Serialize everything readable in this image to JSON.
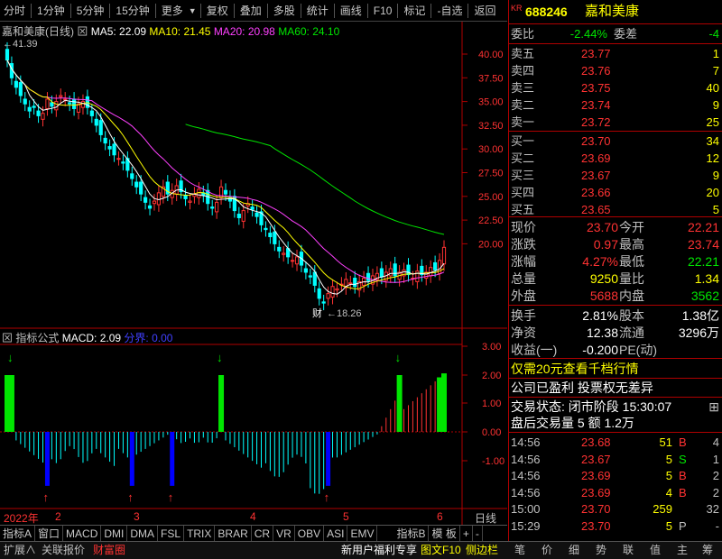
{
  "toolbar": {
    "items": [
      "分时",
      "1分钟",
      "5分钟",
      "15分钟",
      "更多",
      "复权",
      "叠加",
      "多股",
      "统计",
      "画线",
      "F10",
      "标记",
      "-自选",
      "返回"
    ]
  },
  "chart_header": {
    "name": "嘉和美康(日线)",
    "ma5": "MA5: 22.09",
    "ma10": "MA10: 21.45",
    "ma20": "MA20: 20.98",
    "ma60": "MA60: 24.10",
    "high_label": "41.39",
    "low_label": "18.26",
    "cai": "财"
  },
  "price_axis": [
    "40.00",
    "37.50",
    "35.00",
    "32.50",
    "30.00",
    "27.50",
    "25.00",
    "22.50",
    "20.00"
  ],
  "indicator": {
    "title": "指标公式",
    "macd": "MACD: 2.09",
    "boundary": "分界: 0.00",
    "axis": [
      "3.00",
      "2.00",
      "1.00",
      "0.00",
      "-1.00"
    ]
  },
  "date_axis": {
    "year": "2022年",
    "months": [
      "2",
      "3",
      "4",
      "5",
      "6"
    ],
    "period": "日线"
  },
  "bottom_tabs": [
    "指标A",
    "窗口",
    "MACD",
    "DMI",
    "DMA",
    "FSL",
    "TRIX",
    "BRAR",
    "CR",
    "VR",
    "OBV",
    "ASI",
    "EMV",
    "指标B",
    "模 板",
    "+",
    "-"
  ],
  "status_bar": {
    "left": [
      "扩展∧",
      "关联报价",
      "财富圈"
    ],
    "mid": [
      "新用户福利专享",
      "图文F10",
      "侧边栏"
    ],
    "right": [
      "笔",
      "价",
      "细",
      "势",
      "联",
      "值",
      "主",
      "筹"
    ]
  },
  "quote": {
    "kr": "KR",
    "code": "688246",
    "name": "嘉和美康",
    "weibi_label": "委比",
    "weibi": "-2.44%",
    "weicha_label": "委差",
    "weicha": "-4",
    "asks": [
      {
        "l": "卖五",
        "p": "23.77",
        "v": "1"
      },
      {
        "l": "卖四",
        "p": "23.76",
        "v": "7"
      },
      {
        "l": "卖三",
        "p": "23.75",
        "v": "40"
      },
      {
        "l": "卖二",
        "p": "23.74",
        "v": "9"
      },
      {
        "l": "卖一",
        "p": "23.72",
        "v": "25"
      }
    ],
    "bids": [
      {
        "l": "买一",
        "p": "23.70",
        "v": "34"
      },
      {
        "l": "买二",
        "p": "23.69",
        "v": "12"
      },
      {
        "l": "买三",
        "p": "23.67",
        "v": "9"
      },
      {
        "l": "买四",
        "p": "23.66",
        "v": "20"
      },
      {
        "l": "买五",
        "p": "23.65",
        "v": "5"
      }
    ],
    "stats": [
      {
        "l1": "现价",
        "v1": "23.70",
        "l2": "今开",
        "v2": "22.21"
      },
      {
        "l1": "涨跌",
        "v1": "0.97",
        "l2": "最高",
        "v2": "23.74"
      },
      {
        "l1": "涨幅",
        "v1": "4.27%",
        "l2": "最低",
        "v2": "22.21"
      },
      {
        "l1": "总量",
        "v1": "9250",
        "l2": "量比",
        "v2": "1.34"
      },
      {
        "l1": "外盘",
        "v1": "5688",
        "l2": "内盘",
        "v2": "3562"
      }
    ],
    "stats2": [
      {
        "l1": "换手",
        "v1": "2.81%",
        "l2": "股本",
        "v2": "1.38亿"
      },
      {
        "l1": "净资",
        "v1": "12.38",
        "l2": "流通",
        "v2": "3296万"
      },
      {
        "l1": "收益(一)",
        "v1": "-0.200",
        "l2": "PE(动)",
        "v2": ""
      }
    ],
    "promo": "仅需20元查看千档行情",
    "info1": "公司已盈利 投票权无差异",
    "info2": "交易状态: 闭市阶段 15:30:07",
    "info3": "盘后交易量 5 额 1.2万",
    "ticks": [
      {
        "t": "14:56",
        "p": "23.68",
        "v": "51",
        "d": "B",
        "n": "4"
      },
      {
        "t": "14:56",
        "p": "23.67",
        "v": "5",
        "d": "S",
        "n": "1"
      },
      {
        "t": "14:56",
        "p": "23.69",
        "v": "5",
        "d": "B",
        "n": "2"
      },
      {
        "t": "14:56",
        "p": "23.69",
        "v": "4",
        "d": "B",
        "n": "2"
      },
      {
        "t": "15:00",
        "p": "23.70",
        "v": "259",
        "d": "",
        "n": "32"
      },
      {
        "t": "15:29",
        "p": "23.70",
        "v": "5",
        "d": "P",
        "n": "-"
      }
    ]
  },
  "colors": {
    "up": "#ff3232",
    "down": "#00ffff",
    "ma5": "#ffffff",
    "ma10": "#ffff00",
    "ma20": "#ff40ff",
    "ma60": "#00e600"
  }
}
